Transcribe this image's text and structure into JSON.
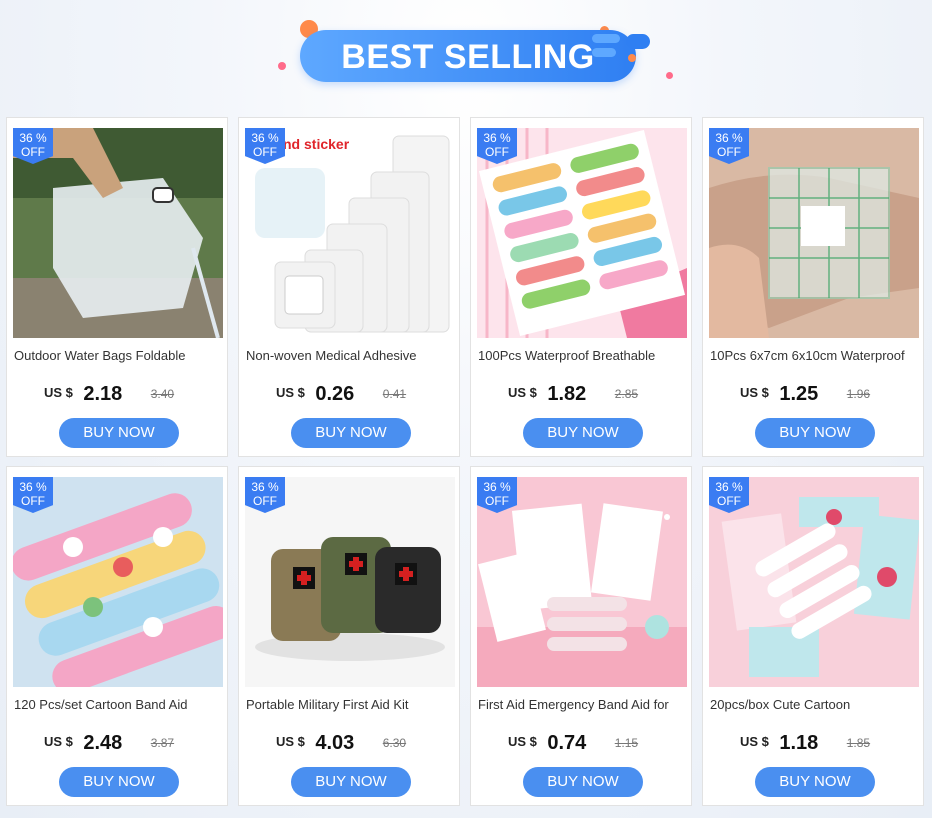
{
  "header": {
    "title": "BEST SELLING"
  },
  "products": [
    {
      "badge_pct": "36 %",
      "badge_off": "OFF",
      "title": "Outdoor Water Bags Foldable",
      "currency": "US $",
      "price": "2.18",
      "old_price": "3.40",
      "buy_label": "BUY NOW"
    },
    {
      "badge_pct": "36 %",
      "badge_off": "OFF",
      "title": "Non-woven Medical Adhesive",
      "currency": "US $",
      "price": "0.26",
      "old_price": "0.41",
      "buy_label": "BUY NOW",
      "image_text": "nd sticker"
    },
    {
      "badge_pct": "36 %",
      "badge_off": "OFF",
      "title": "100Pcs Waterproof Breathable",
      "currency": "US $",
      "price": "1.82",
      "old_price": "2.85",
      "buy_label": "BUY NOW"
    },
    {
      "badge_pct": "36 %",
      "badge_off": "OFF",
      "title": "10Pcs 6x7cm 6x10cm Waterproof",
      "currency": "US $",
      "price": "1.25",
      "old_price": "1.96",
      "buy_label": "BUY NOW"
    },
    {
      "badge_pct": "36 %",
      "badge_off": "OFF",
      "title": "120 Pcs/set Cartoon Band Aid",
      "currency": "US $",
      "price": "2.48",
      "old_price": "3.87",
      "buy_label": "BUY NOW"
    },
    {
      "badge_pct": "36 %",
      "badge_off": "OFF",
      "title": "Portable Military First Aid Kit",
      "currency": "US $",
      "price": "4.03",
      "old_price": "6.30",
      "buy_label": "BUY NOW"
    },
    {
      "badge_pct": "36 %",
      "badge_off": "OFF",
      "title": "First Aid Emergency Band Aid for",
      "currency": "US $",
      "price": "0.74",
      "old_price": "1.15",
      "buy_label": "BUY NOW"
    },
    {
      "badge_pct": "36 %",
      "badge_off": "OFF",
      "title": "20pcs/box Cute Cartoon",
      "currency": "US $",
      "price": "1.18",
      "old_price": "1.85",
      "buy_label": "BUY NOW"
    }
  ],
  "colors": {
    "accent": "#3a7cf2",
    "button": "#4a8ff0",
    "header_pill": "#2f7ff2"
  }
}
